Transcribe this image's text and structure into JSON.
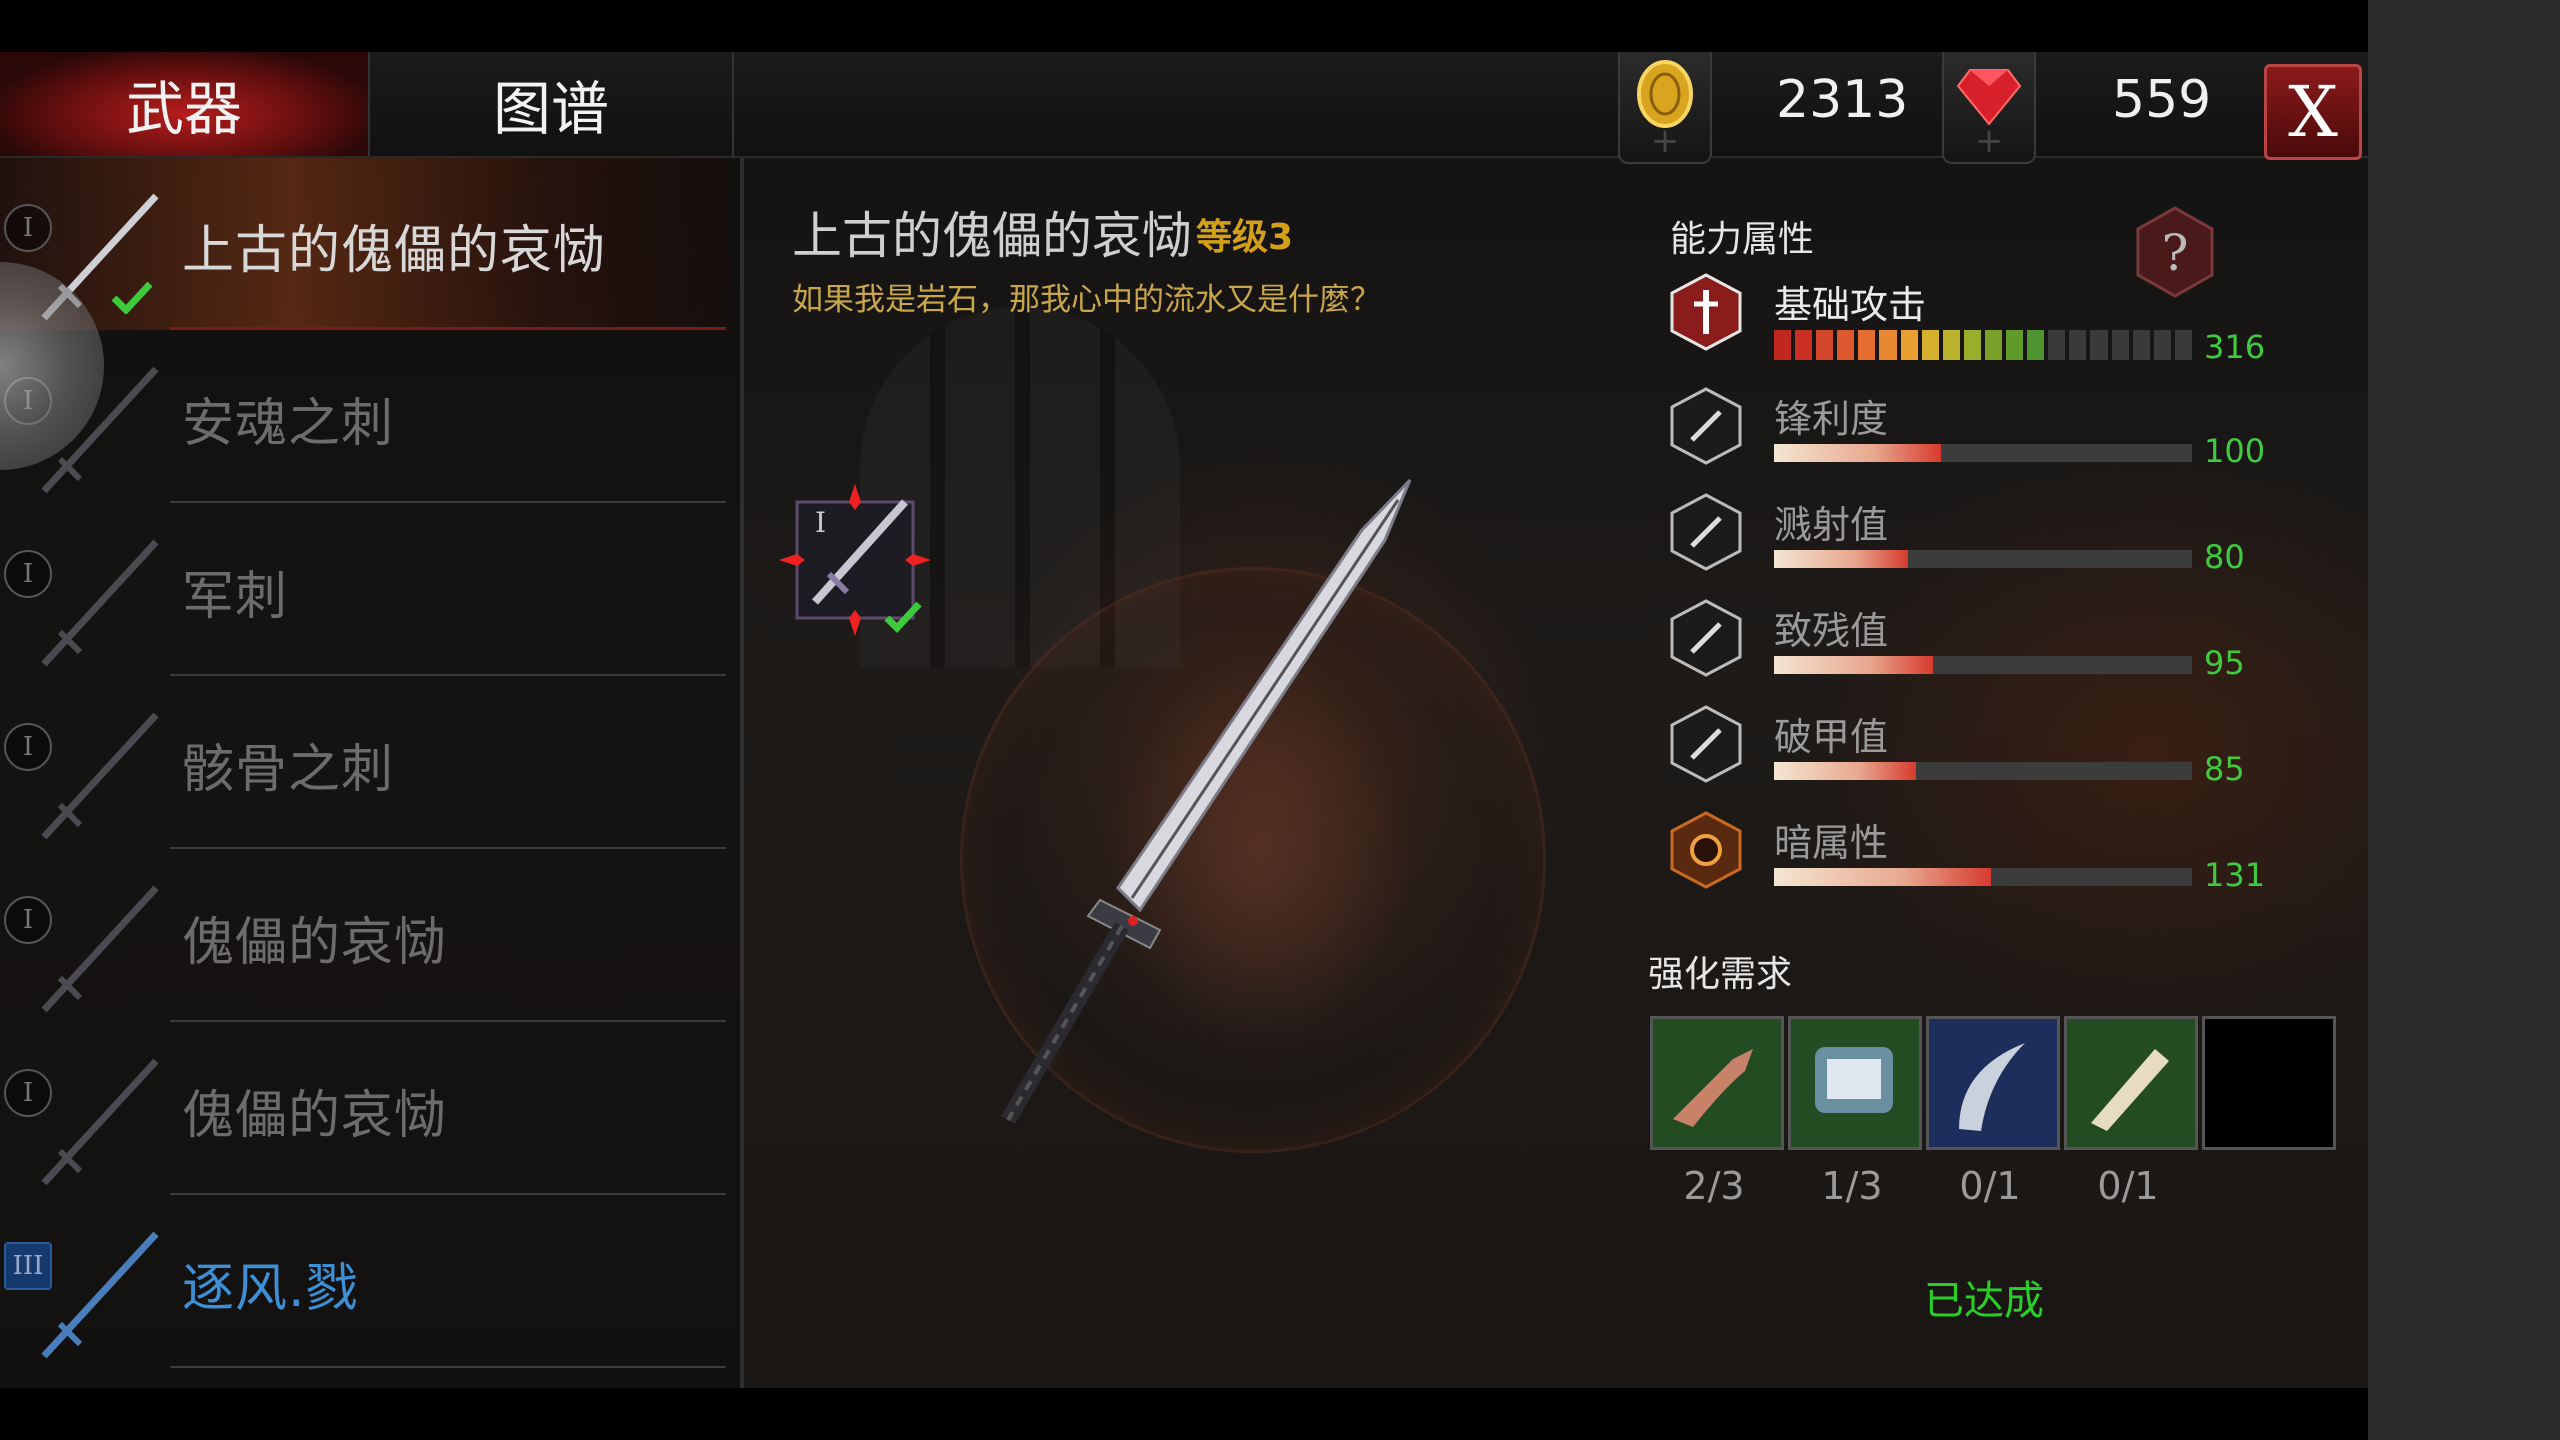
{
  "tabs": {
    "weapon": "武器",
    "atlas": "图谱"
  },
  "currency": {
    "gold": "2313",
    "gems": "559"
  },
  "close_label": "X",
  "weapons": [
    {
      "name": "上古的傀儡的哀恸",
      "tier": "I",
      "active": true,
      "equipped": true
    },
    {
      "name": "安魂之刺",
      "tier": "I"
    },
    {
      "name": "军刺",
      "tier": "I"
    },
    {
      "name": "骸骨之刺",
      "tier": "I"
    },
    {
      "name": "傀儡的哀恸",
      "tier": "I"
    },
    {
      "name": "傀儡的哀恸",
      "tier": "I"
    },
    {
      "name": "逐风.戮",
      "tier": "III",
      "special": true
    }
  ],
  "detail": {
    "name": "上古的傀儡的哀恸",
    "level": "等级3",
    "description": "如果我是岩石，那我心中的流水又是什麼？",
    "gem_tier": "I"
  },
  "stats_title": "能力属性",
  "stats": [
    {
      "name": "基础攻击",
      "value": "316",
      "level": 0.63
    },
    {
      "name": "锋利度",
      "value": "100",
      "level": 0.4
    },
    {
      "name": "溅射值",
      "value": "80",
      "level": 0.32
    },
    {
      "name": "致残值",
      "value": "95",
      "level": 0.38
    },
    {
      "name": "破甲值",
      "value": "85",
      "level": 0.34
    },
    {
      "name": "暗属性",
      "value": "131",
      "level": 0.52
    }
  ],
  "requirements_title": "强化需求",
  "requirements": [
    {
      "count": "2/3",
      "icon": "claw-material-icon"
    },
    {
      "count": "1/3",
      "icon": "crystal-ore-icon"
    },
    {
      "count": "0/1",
      "icon": "fang-icon"
    },
    {
      "count": "0/1",
      "icon": "bone-icon"
    }
  ],
  "status": "已达成"
}
